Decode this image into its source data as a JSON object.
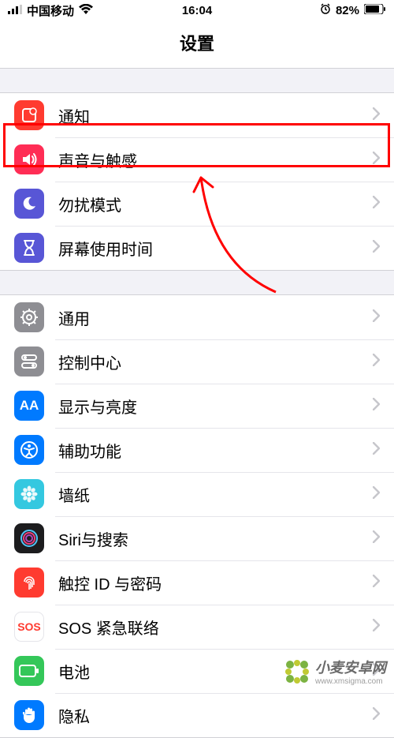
{
  "status": {
    "carrier": "中国移动",
    "time": "16:04",
    "battery_pct": "82%"
  },
  "header": {
    "title": "设置"
  },
  "groups": [
    {
      "items": [
        {
          "key": "notifications",
          "label": "通知",
          "icon": "notification-icon",
          "bg": "#ff3b30"
        },
        {
          "key": "sounds",
          "label": "声音与触感",
          "icon": "sound-icon",
          "bg": "#ff3b30",
          "highlighted": true
        },
        {
          "key": "dnd",
          "label": "勿扰模式",
          "icon": "moon-icon",
          "bg": "#5856d6"
        },
        {
          "key": "screentime",
          "label": "屏幕使用时间",
          "icon": "hourglass-icon",
          "bg": "#5856d6"
        }
      ]
    },
    {
      "items": [
        {
          "key": "general",
          "label": "通用",
          "icon": "gear-icon",
          "bg": "#8e8e93"
        },
        {
          "key": "controlcenter",
          "label": "控制中心",
          "icon": "switches-icon",
          "bg": "#8e8e93"
        },
        {
          "key": "display",
          "label": "显示与亮度",
          "icon": "aa-icon",
          "bg": "#007aff"
        },
        {
          "key": "accessibility",
          "label": "辅助功能",
          "icon": "accessibility-icon",
          "bg": "#007aff"
        },
        {
          "key": "wallpaper",
          "label": "墙纸",
          "icon": "flower-icon",
          "bg": "#34c8e0"
        },
        {
          "key": "siri",
          "label": "Siri与搜索",
          "icon": "siri-icon",
          "bg": "#1c1c1e"
        },
        {
          "key": "touchid",
          "label": "触控 ID 与密码",
          "icon": "fingerprint-icon",
          "bg": "#ff3b30"
        },
        {
          "key": "sos",
          "label": "SOS 紧急联络",
          "icon": "sos-icon",
          "bg": "#ffffff",
          "fg": "#ff3b30",
          "border": true
        },
        {
          "key": "battery",
          "label": "电池",
          "icon": "battery-icon",
          "bg": "#34c759"
        },
        {
          "key": "privacy",
          "label": "隐私",
          "icon": "hand-icon",
          "bg": "#007aff"
        }
      ]
    }
  ],
  "watermark": {
    "text": "小麦安卓网",
    "site": "www.xmsigma.com"
  }
}
